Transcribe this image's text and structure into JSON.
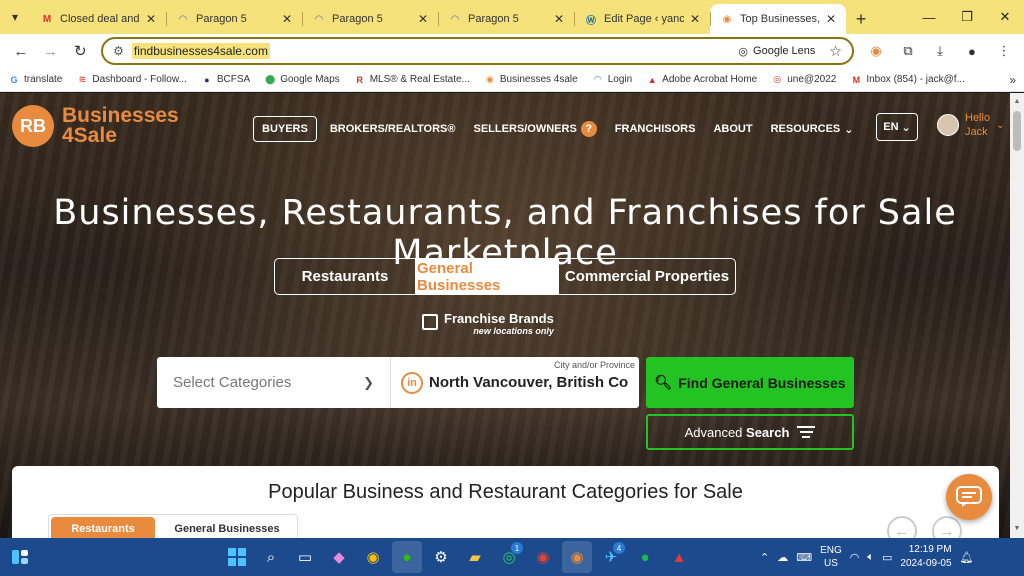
{
  "browser": {
    "tabs": [
      {
        "favicon": "gmail-icon",
        "title": "Closed deal and pl",
        "active": false
      },
      {
        "favicon": "paragon-icon",
        "title": "Paragon 5",
        "active": false
      },
      {
        "favicon": "paragon-icon",
        "title": "Paragon 5",
        "active": false
      },
      {
        "favicon": "paragon-icon",
        "title": "Paragon 5",
        "active": false
      },
      {
        "favicon": "wordpress-icon",
        "title": "Edit Page ‹ yancan",
        "active": false
      },
      {
        "favicon": "businesses4sale-icon",
        "title": "Top Businesses, Re",
        "active": true
      }
    ],
    "url": "findbusinesses4sale.com",
    "lens_label": "Google Lens",
    "bookmarks": [
      {
        "icon": "google-icon",
        "label": "translate"
      },
      {
        "icon": "dashboard-icon",
        "label": "Dashboard - Follow..."
      },
      {
        "icon": "bcfsa-icon",
        "label": "BCFSA"
      },
      {
        "icon": "maps-icon",
        "label": "Google Maps"
      },
      {
        "icon": "mls-icon",
        "label": "MLS® & Real Estate..."
      },
      {
        "icon": "businesses4sale-icon",
        "label": "Businesses 4sale"
      },
      {
        "icon": "login-icon",
        "label": "Login"
      },
      {
        "icon": "acrobat-icon",
        "label": "Adobe Acrobat Home"
      },
      {
        "icon": "une-icon",
        "label": "une@2022"
      },
      {
        "icon": "gmail-icon",
        "label": "Inbox (854) - jack@f..."
      }
    ]
  },
  "site": {
    "logo_line1": "Businesses",
    "logo_line2": "4Sale",
    "nav": {
      "buyers": "BUYERS",
      "brokers": "BROKERS/REALTORS®",
      "sellers": "SELLERS/OWNERS",
      "franchisors": "FRANCHISORS",
      "about": "ABOUT",
      "resources": "RESOURCES"
    },
    "lang": "EN",
    "hello": "Hello",
    "user_name": "Jack",
    "hero_title": "Businesses, Restaurants, and Franchises for Sale Marketplace",
    "type_tabs": {
      "restaurants": "Restaurants",
      "general": "General Businesses",
      "commercial": "Commercial Properties"
    },
    "franchise_label": "Franchise Brands",
    "franchise_sub": "new locations only",
    "search": {
      "select_placeholder": "Select Categories",
      "location_label": "City and/or Province",
      "location_value": "North Vancouver, British Co",
      "find_button": "Find General Businesses",
      "advanced_prefix": "Advanced",
      "advanced_bold": "Search"
    },
    "categories": {
      "title": "Popular Business and Restaurant Categories for Sale",
      "tab_restaurants": "Restaurants",
      "tab_general": "General Businesses"
    }
  },
  "taskbar": {
    "lang_line1": "ENG",
    "lang_line2": "US",
    "time": "12:19 PM",
    "date": "2024-09-05",
    "badge_count": "1",
    "badge_count_2": "4"
  }
}
